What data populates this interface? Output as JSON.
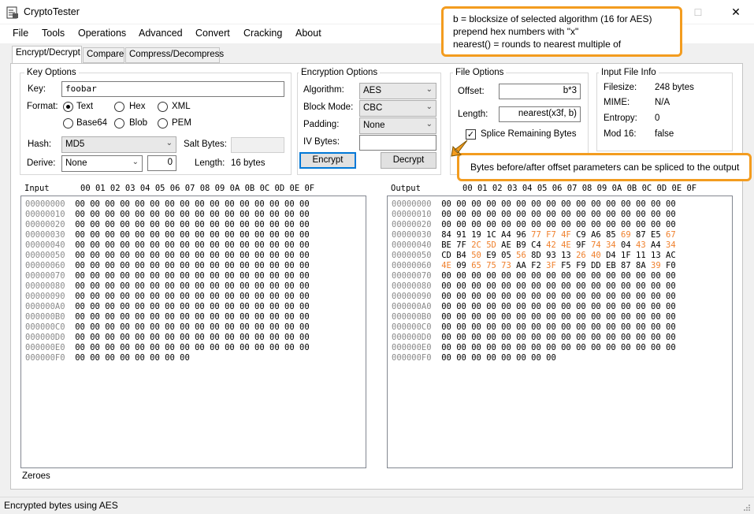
{
  "window": {
    "title": "CryptoTester",
    "minimize_glyph": "—",
    "maximize_glyph": "☐",
    "close_glyph": "✕"
  },
  "menu": [
    "File",
    "Tools",
    "Operations",
    "Advanced",
    "Convert",
    "Cracking",
    "About"
  ],
  "tabs": [
    "Encrypt/Decrypt",
    "Compare",
    "Compress/Decompress"
  ],
  "key_options": {
    "title": "Key Options",
    "key_label": "Key:",
    "key_value": "foobar",
    "format_label": "Format:",
    "formats": [
      "Text",
      "Hex",
      "XML",
      "Base64",
      "Blob",
      "PEM"
    ],
    "selected_format": "Text",
    "hash_label": "Hash:",
    "hash_value": "MD5",
    "salt_label": "Salt Bytes:",
    "salt_value": "",
    "derive_label": "Derive:",
    "derive_value": "None",
    "derive_number": "0",
    "length_label": "Length:",
    "length_value": "16 bytes"
  },
  "encryption_options": {
    "title": "Encryption Options",
    "algorithm_label": "Algorithm:",
    "algorithm_value": "AES",
    "block_mode_label": "Block Mode:",
    "block_mode_value": "CBC",
    "padding_label": "Padding:",
    "padding_value": "None",
    "iv_label": "IV Bytes:",
    "iv_value": "",
    "encrypt_label": "Encrypt",
    "decrypt_label": "Decrypt"
  },
  "file_options": {
    "title": "File Options",
    "offset_label": "Offset:",
    "offset_value": "b*3",
    "length_label": "Length:",
    "length_value": "nearest(x3f, b)",
    "splice_label": "Splice Remaining Bytes",
    "splice_checked": true
  },
  "input_file_info": {
    "title": "Input File Info",
    "filesize_label": "Filesize:",
    "filesize_value": "248 bytes",
    "mime_label": "MIME:",
    "mime_value": "N/A",
    "entropy_label": "Entropy:",
    "entropy_value": "0",
    "mod16_label": "Mod 16:",
    "mod16_value": "false"
  },
  "input_panel": {
    "label": "Input",
    "column_header": "00 01 02 03 04 05 06 07 08 09 0A 0B 0C 0D 0E 0F",
    "rows": [
      {
        "addr": "00000000",
        "bytes": [
          "00",
          "00",
          "00",
          "00",
          "00",
          "00",
          "00",
          "00",
          "00",
          "00",
          "00",
          "00",
          "00",
          "00",
          "00",
          "00"
        ]
      },
      {
        "addr": "00000010",
        "bytes": [
          "00",
          "00",
          "00",
          "00",
          "00",
          "00",
          "00",
          "00",
          "00",
          "00",
          "00",
          "00",
          "00",
          "00",
          "00",
          "00"
        ]
      },
      {
        "addr": "00000020",
        "bytes": [
          "00",
          "00",
          "00",
          "00",
          "00",
          "00",
          "00",
          "00",
          "00",
          "00",
          "00",
          "00",
          "00",
          "00",
          "00",
          "00"
        ]
      },
      {
        "addr": "00000030",
        "bytes": [
          "00",
          "00",
          "00",
          "00",
          "00",
          "00",
          "00",
          "00",
          "00",
          "00",
          "00",
          "00",
          "00",
          "00",
          "00",
          "00"
        ]
      },
      {
        "addr": "00000040",
        "bytes": [
          "00",
          "00",
          "00",
          "00",
          "00",
          "00",
          "00",
          "00",
          "00",
          "00",
          "00",
          "00",
          "00",
          "00",
          "00",
          "00"
        ]
      },
      {
        "addr": "00000050",
        "bytes": [
          "00",
          "00",
          "00",
          "00",
          "00",
          "00",
          "00",
          "00",
          "00",
          "00",
          "00",
          "00",
          "00",
          "00",
          "00",
          "00"
        ]
      },
      {
        "addr": "00000060",
        "bytes": [
          "00",
          "00",
          "00",
          "00",
          "00",
          "00",
          "00",
          "00",
          "00",
          "00",
          "00",
          "00",
          "00",
          "00",
          "00",
          "00"
        ]
      },
      {
        "addr": "00000070",
        "bytes": [
          "00",
          "00",
          "00",
          "00",
          "00",
          "00",
          "00",
          "00",
          "00",
          "00",
          "00",
          "00",
          "00",
          "00",
          "00",
          "00"
        ]
      },
      {
        "addr": "00000080",
        "bytes": [
          "00",
          "00",
          "00",
          "00",
          "00",
          "00",
          "00",
          "00",
          "00",
          "00",
          "00",
          "00",
          "00",
          "00",
          "00",
          "00"
        ]
      },
      {
        "addr": "00000090",
        "bytes": [
          "00",
          "00",
          "00",
          "00",
          "00",
          "00",
          "00",
          "00",
          "00",
          "00",
          "00",
          "00",
          "00",
          "00",
          "00",
          "00"
        ]
      },
      {
        "addr": "000000A0",
        "bytes": [
          "00",
          "00",
          "00",
          "00",
          "00",
          "00",
          "00",
          "00",
          "00",
          "00",
          "00",
          "00",
          "00",
          "00",
          "00",
          "00"
        ]
      },
      {
        "addr": "000000B0",
        "bytes": [
          "00",
          "00",
          "00",
          "00",
          "00",
          "00",
          "00",
          "00",
          "00",
          "00",
          "00",
          "00",
          "00",
          "00",
          "00",
          "00"
        ]
      },
      {
        "addr": "000000C0",
        "bytes": [
          "00",
          "00",
          "00",
          "00",
          "00",
          "00",
          "00",
          "00",
          "00",
          "00",
          "00",
          "00",
          "00",
          "00",
          "00",
          "00"
        ]
      },
      {
        "addr": "000000D0",
        "bytes": [
          "00",
          "00",
          "00",
          "00",
          "00",
          "00",
          "00",
          "00",
          "00",
          "00",
          "00",
          "00",
          "00",
          "00",
          "00",
          "00"
        ]
      },
      {
        "addr": "000000E0",
        "bytes": [
          "00",
          "00",
          "00",
          "00",
          "00",
          "00",
          "00",
          "00",
          "00",
          "00",
          "00",
          "00",
          "00",
          "00",
          "00",
          "00"
        ]
      },
      {
        "addr": "000000F0",
        "bytes": [
          "00",
          "00",
          "00",
          "00",
          "00",
          "00",
          "00",
          "00"
        ]
      }
    ]
  },
  "output_panel": {
    "label": "Output",
    "column_header": "00 01 02 03 04 05 06 07 08 09 0A 0B 0C 0D 0E 0F",
    "highlight_color": "#f0802c",
    "rows": [
      {
        "addr": "00000000",
        "bytes": [
          "00",
          "00",
          "00",
          "00",
          "00",
          "00",
          "00",
          "00",
          "00",
          "00",
          "00",
          "00",
          "00",
          "00",
          "00",
          "00"
        ],
        "hl": []
      },
      {
        "addr": "00000010",
        "bytes": [
          "00",
          "00",
          "00",
          "00",
          "00",
          "00",
          "00",
          "00",
          "00",
          "00",
          "00",
          "00",
          "00",
          "00",
          "00",
          "00"
        ],
        "hl": []
      },
      {
        "addr": "00000020",
        "bytes": [
          "00",
          "00",
          "00",
          "00",
          "00",
          "00",
          "00",
          "00",
          "00",
          "00",
          "00",
          "00",
          "00",
          "00",
          "00",
          "00"
        ],
        "hl": []
      },
      {
        "addr": "00000030",
        "bytes": [
          "84",
          "91",
          "19",
          "1C",
          "A4",
          "96",
          "77",
          "F7",
          "4F",
          "C9",
          "A6",
          "85",
          "69",
          "87",
          "E5",
          "67"
        ],
        "hl": [
          6,
          7,
          8,
          12,
          15
        ]
      },
      {
        "addr": "00000040",
        "bytes": [
          "BE",
          "7F",
          "2C",
          "5D",
          "AE",
          "B9",
          "C4",
          "42",
          "4E",
          "9F",
          "74",
          "34",
          "04",
          "43",
          "A4",
          "34"
        ],
        "hl": [
          2,
          3,
          7,
          8,
          10,
          11,
          13,
          15
        ]
      },
      {
        "addr": "00000050",
        "bytes": [
          "CD",
          "B4",
          "50",
          "E9",
          "05",
          "56",
          "8D",
          "93",
          "13",
          "26",
          "40",
          "D4",
          "1F",
          "11",
          "13",
          "AC"
        ],
        "hl": [
          2,
          5,
          9,
          10
        ]
      },
      {
        "addr": "00000060",
        "bytes": [
          "4E",
          "09",
          "65",
          "75",
          "73",
          "AA",
          "F2",
          "3F",
          "F5",
          "F9",
          "DD",
          "EB",
          "87",
          "8A",
          "39",
          "F0"
        ],
        "hl": [
          0,
          2,
          3,
          4,
          7,
          14
        ]
      },
      {
        "addr": "00000070",
        "bytes": [
          "00",
          "00",
          "00",
          "00",
          "00",
          "00",
          "00",
          "00",
          "00",
          "00",
          "00",
          "00",
          "00",
          "00",
          "00",
          "00"
        ],
        "hl": []
      },
      {
        "addr": "00000080",
        "bytes": [
          "00",
          "00",
          "00",
          "00",
          "00",
          "00",
          "00",
          "00",
          "00",
          "00",
          "00",
          "00",
          "00",
          "00",
          "00",
          "00"
        ],
        "hl": []
      },
      {
        "addr": "00000090",
        "bytes": [
          "00",
          "00",
          "00",
          "00",
          "00",
          "00",
          "00",
          "00",
          "00",
          "00",
          "00",
          "00",
          "00",
          "00",
          "00",
          "00"
        ],
        "hl": []
      },
      {
        "addr": "000000A0",
        "bytes": [
          "00",
          "00",
          "00",
          "00",
          "00",
          "00",
          "00",
          "00",
          "00",
          "00",
          "00",
          "00",
          "00",
          "00",
          "00",
          "00"
        ],
        "hl": []
      },
      {
        "addr": "000000B0",
        "bytes": [
          "00",
          "00",
          "00",
          "00",
          "00",
          "00",
          "00",
          "00",
          "00",
          "00",
          "00",
          "00",
          "00",
          "00",
          "00",
          "00"
        ],
        "hl": []
      },
      {
        "addr": "000000C0",
        "bytes": [
          "00",
          "00",
          "00",
          "00",
          "00",
          "00",
          "00",
          "00",
          "00",
          "00",
          "00",
          "00",
          "00",
          "00",
          "00",
          "00"
        ],
        "hl": []
      },
      {
        "addr": "000000D0",
        "bytes": [
          "00",
          "00",
          "00",
          "00",
          "00",
          "00",
          "00",
          "00",
          "00",
          "00",
          "00",
          "00",
          "00",
          "00",
          "00",
          "00"
        ],
        "hl": []
      },
      {
        "addr": "000000E0",
        "bytes": [
          "00",
          "00",
          "00",
          "00",
          "00",
          "00",
          "00",
          "00",
          "00",
          "00",
          "00",
          "00",
          "00",
          "00",
          "00",
          "00"
        ],
        "hl": []
      },
      {
        "addr": "000000F0",
        "bytes": [
          "00",
          "00",
          "00",
          "00",
          "00",
          "00",
          "00",
          "00"
        ],
        "hl": []
      }
    ]
  },
  "zeroes_label": "Zeroes",
  "status_text": "Encrypted bytes using AES",
  "callouts": {
    "top": [
      "b = blocksize of selected algorithm (16 for AES)",
      "prepend hex numbers with \"x\"",
      "nearest() = rounds to nearest multiple of"
    ],
    "bottom": "Bytes before/after offset parameters can be spliced to the output",
    "accent_color": "#f39c1f"
  }
}
